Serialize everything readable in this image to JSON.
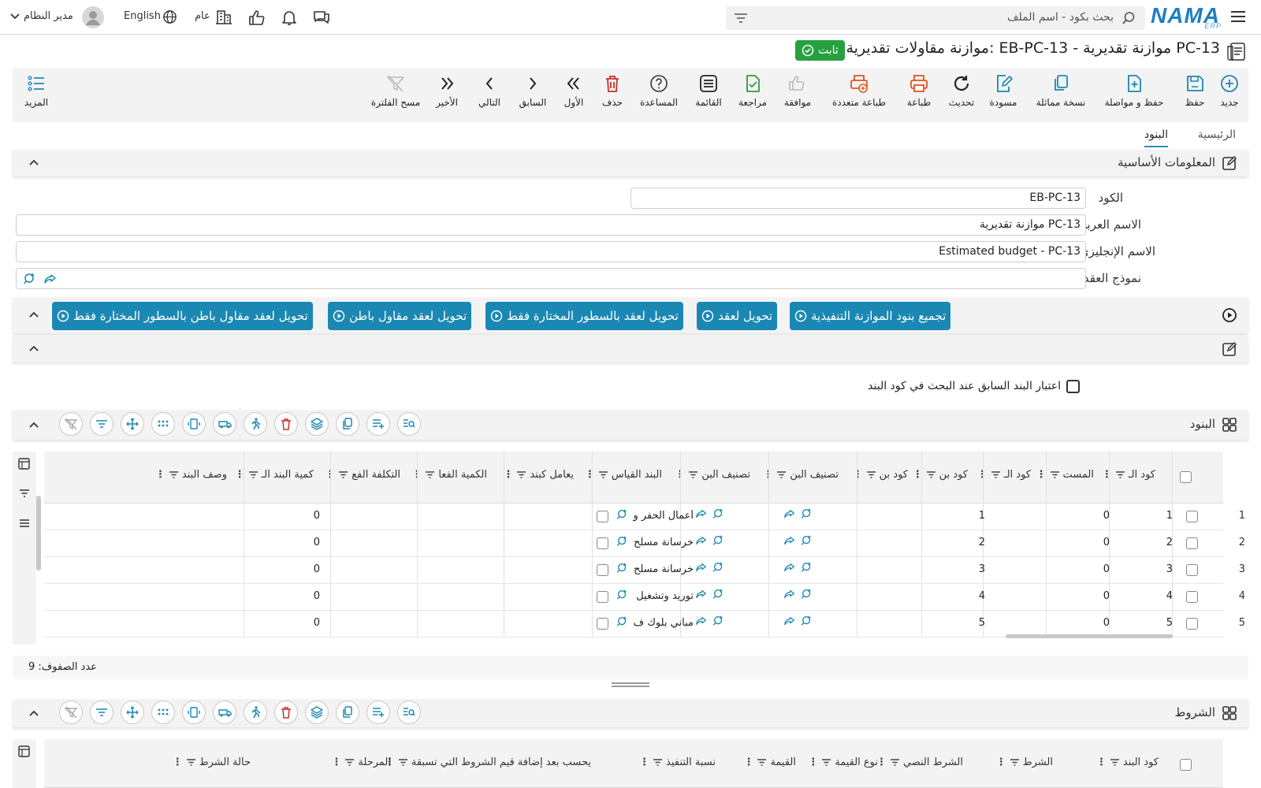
{
  "header": {
    "logo": "NAMA",
    "logo_sub": "ERP",
    "search_placeholder": "بحث بكود - اسم الملف",
    "user_name": "مدير النظام",
    "language": "English",
    "branch": "عام"
  },
  "page": {
    "title": "موازنة مقاولات تقديرية: EB-PC-13 - موازنة تقديرية PC-13",
    "status_badge": "ثابت"
  },
  "toolbar": {
    "buttons": [
      {
        "label": "جديد",
        "icon": "plus-circle-icon"
      },
      {
        "label": "حفظ",
        "icon": "save-icon"
      },
      {
        "label": "حفظ و مواصلة",
        "icon": "save-continue-icon"
      },
      {
        "label": "نسخة مماثلة",
        "icon": "copy-icon"
      },
      {
        "label": "مسودة",
        "icon": "draft-icon"
      },
      {
        "label": "تحديث",
        "icon": "refresh-icon"
      },
      {
        "label": "طباعة",
        "icon": "print-icon"
      },
      {
        "label": "طباعة متعددة",
        "icon": "multi-print-icon"
      },
      {
        "label": "موافقة",
        "icon": "thumbs-up-icon"
      },
      {
        "label": "مراجعة",
        "icon": "review-icon"
      },
      {
        "label": "القائمة",
        "icon": "list-icon"
      },
      {
        "label": "المساعدة",
        "icon": "help-icon"
      },
      {
        "label": "حذف",
        "icon": "trash-icon"
      },
      {
        "label": "الأول",
        "icon": "first-icon"
      },
      {
        "label": "السابق",
        "icon": "prev-icon"
      },
      {
        "label": "التالي",
        "icon": "next-icon"
      },
      {
        "label": "الأخير",
        "icon": "last-icon"
      },
      {
        "label": "مسح الفلترة",
        "icon": "clear-filter-icon"
      }
    ],
    "more_label": "المزيد"
  },
  "tabs": [
    "الرئيسية",
    "البنود"
  ],
  "basic_info": {
    "title": "المعلومات الأساسية",
    "code_label": "الكود",
    "code_value": "EB-PC-13",
    "arabic_name_label": "الاسم العربي",
    "arabic_name_value": "موازنة تقديرية PC-13",
    "english_name_label": "الاسم الإنجليزي",
    "english_name_value": "Estimated budget - PC-13",
    "contract_model_label": "نموذج العقد"
  },
  "actions": [
    "تجميع بنود الموازنة التنفيذية",
    "تحويل لعقد",
    "تحويل لعقد بالسطور المختارة فقط",
    "تحويل لعقد مقاول باطن",
    "تحويل لعقد مقاول باطن بالسطور المختارة فقط"
  ],
  "option_checkbox_label": "اعتبار البند السابق عند البحث في كود البند",
  "items_section": {
    "title": "البنود",
    "columns": [
      "كود الـ",
      "المست",
      "كود الـ",
      "كود بن",
      "كود بن",
      "تصنيف البن",
      "تصنيف البن",
      "البند القياس",
      "يعامل كبند",
      "الكمية الفعا",
      "التكلفة الفع",
      "كمية البند الـ",
      "وصف البند"
    ],
    "rows": [
      {
        "num": "1",
        "code": "1",
        "level": "0",
        "item_code": "1",
        "name": "أعمال الحفر و",
        "qty": "0"
      },
      {
        "num": "2",
        "code": "2",
        "level": "0",
        "item_code": "2",
        "name": "خرسانة مسلح",
        "qty": "0"
      },
      {
        "num": "3",
        "code": "3",
        "level": "0",
        "item_code": "3",
        "name": "خرسانة مسلح",
        "qty": "0"
      },
      {
        "num": "4",
        "code": "4",
        "level": "0",
        "item_code": "4",
        "name": "توريد وتشغيل",
        "qty": "0"
      },
      {
        "num": "5",
        "code": "5",
        "level": "0",
        "item_code": "5",
        "name": "مباني بلوك ف",
        "qty": "0"
      }
    ],
    "row_count_label": "عدد الصفوف: 9"
  },
  "conditions_section": {
    "title": "الشروط",
    "columns": [
      "كود البند",
      "الشرط",
      "الشرط النصي",
      "نوع القيمة",
      "القيمة",
      "نسبة التنفيذ",
      "يحسب بعد إضافة قيم الشروط التي تسبقة",
      "المرحلة",
      "حالة الشرط"
    ]
  },
  "colors": {
    "accent": "#1b88b3",
    "badge": "#27a040",
    "print": "#e0531f",
    "delete": "#c9302c",
    "review": "#2f9a3c"
  }
}
